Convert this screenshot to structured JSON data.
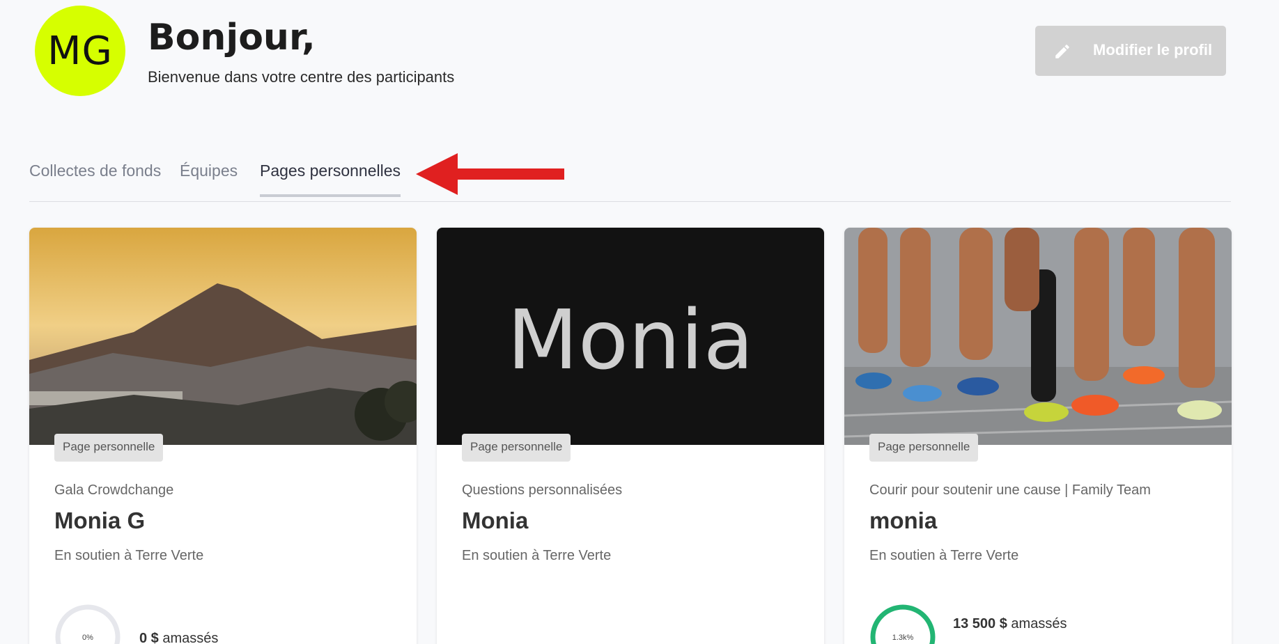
{
  "header": {
    "avatar_initials": "MG",
    "avatar_color": "#d6ff00",
    "greeting": "Bonjour,",
    "welcome": "Bienvenue dans votre centre des participants",
    "edit_profile_label": "Modifier le profil"
  },
  "tabs": [
    {
      "label": "Collectes de fonds",
      "active": false
    },
    {
      "label": "Équipes",
      "active": false
    },
    {
      "label": "Pages personnelles",
      "active": true
    }
  ],
  "cards": [
    {
      "badge": "Page personnelle",
      "subtitle": "Gala Crowdchange",
      "name": "Monia G",
      "support": "En soutien à Terre Verte",
      "progress_label": "0%",
      "progress": 0,
      "raised_amount": "0 $",
      "raised_suffix": "amassés",
      "image": "mountain-volcano-sunrise"
    },
    {
      "badge": "Page personnelle",
      "subtitle": "Questions personnalisées",
      "name": "Monia",
      "support": "En soutien à Terre Verte",
      "hero_text": "Monia",
      "image": "text-banner"
    },
    {
      "badge": "Page personnelle",
      "subtitle": "Courir pour soutenir une cause | Family Team",
      "name": "monia",
      "support": "En soutien à Terre Verte",
      "progress_label": "1.3k%",
      "progress": 1,
      "raised_amount": "13 500 $",
      "raised_suffix": "amassés",
      "image": "runners-legs"
    }
  ],
  "colors": {
    "accent_green": "#22b573",
    "annotation_arrow": "#e02020"
  }
}
